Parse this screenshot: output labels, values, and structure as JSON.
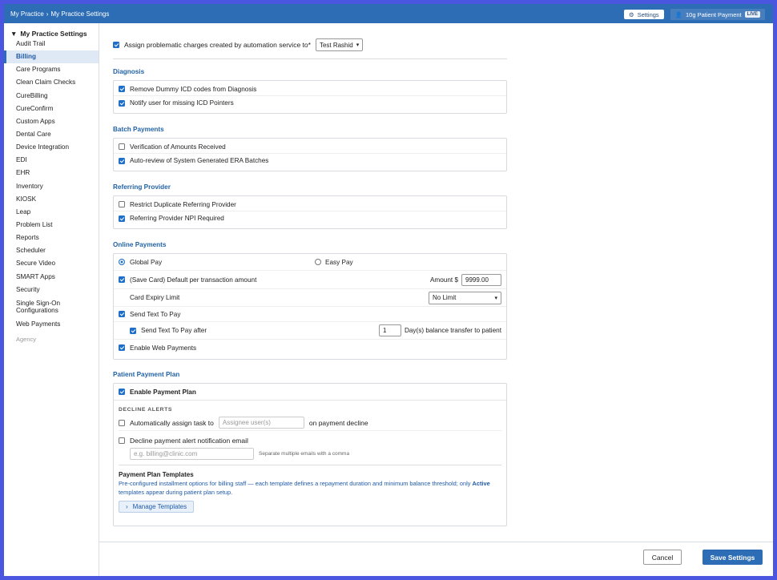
{
  "topbar": {
    "crumbs": [
      "My Practice",
      "My Practice Settings"
    ],
    "crumb_sep": "›",
    "settings_label": "Settings",
    "patient_payment_label": "10g Patient Payment",
    "live_badge": "LIVE"
  },
  "sidebar": {
    "heading": "My Practice Settings",
    "items": [
      "Audit Trail",
      "Billing",
      "Care Programs",
      "Clean Claim Checks",
      "CureBilling",
      "CureConfirm",
      "Custom Apps",
      "Dental Care",
      "Device Integration",
      "EDI",
      "EHR",
      "Inventory",
      "KIOSK",
      "Leap",
      "Problem List",
      "Reports",
      "Scheduler",
      "Secure Video",
      "SMART Apps",
      "Security"
    ],
    "sso_line1": "Single Sign-On",
    "sso_line2": "Configurations",
    "web_payments": "Web Payments",
    "agency": "Agency",
    "active": "Billing"
  },
  "assign": {
    "label": "Assign problematic charges created by automation service to*",
    "selected": "Test Rashid"
  },
  "diagnosis": {
    "title": "Diagnosis",
    "items": [
      {
        "label": "Remove Dummy ICD codes from Diagnosis",
        "checked": true
      },
      {
        "label": "Notify user for missing ICD Pointers",
        "checked": true
      }
    ]
  },
  "batch": {
    "title": "Batch Payments",
    "items": [
      {
        "label": "Verification of Amounts Received",
        "checked": false
      },
      {
        "label": "Auto-review of System Generated ERA Batches",
        "checked": true
      }
    ]
  },
  "referring": {
    "title": "Referring Provider",
    "items": [
      {
        "label": "Restrict Duplicate Referring Provider",
        "checked": false
      },
      {
        "label": "Referring Provider NPI Required",
        "checked": true
      }
    ]
  },
  "online": {
    "title": "Online Payments",
    "global_pay": "Global Pay",
    "easy_pay": "Easy Pay",
    "save_card": "(Save Card) Default per transaction amount",
    "amount_label": "Amount $",
    "amount_value": "9999.00",
    "expiry_label": "Card Expiry Limit",
    "expiry_value": "No Limit",
    "send_text": "Send Text To Pay",
    "send_text_after": "Send Text To Pay after",
    "days_value": "1",
    "days_label": "Day(s) balance transfer to patient",
    "web_payments": "Enable Web Payments"
  },
  "plan": {
    "title": "Patient Payment Plan",
    "enable": "Enable Payment Plan",
    "decline_alerts": "DECLINE ALERTS",
    "auto_assign": "Automatically assign task to",
    "assignee_placeholder": "Assignee user(s)",
    "on_decline": "on payment decline",
    "decline_email": "Decline payment alert notification email",
    "email_placeholder": "e.g. billing@clinic.com",
    "email_help": "Separate multiple emails with a comma",
    "templates_title": "Payment Plan Templates",
    "templates_desc_1": "Pre-configured installment options for billing staff — each template defines a repayment duration and minimum balance threshold; only",
    "templates_active": "Active",
    "templates_desc_2": "templates appear during patient plan setup.",
    "manage_label": "Manage Templates"
  },
  "footer": {
    "cancel": "Cancel",
    "save": "Save Settings"
  }
}
